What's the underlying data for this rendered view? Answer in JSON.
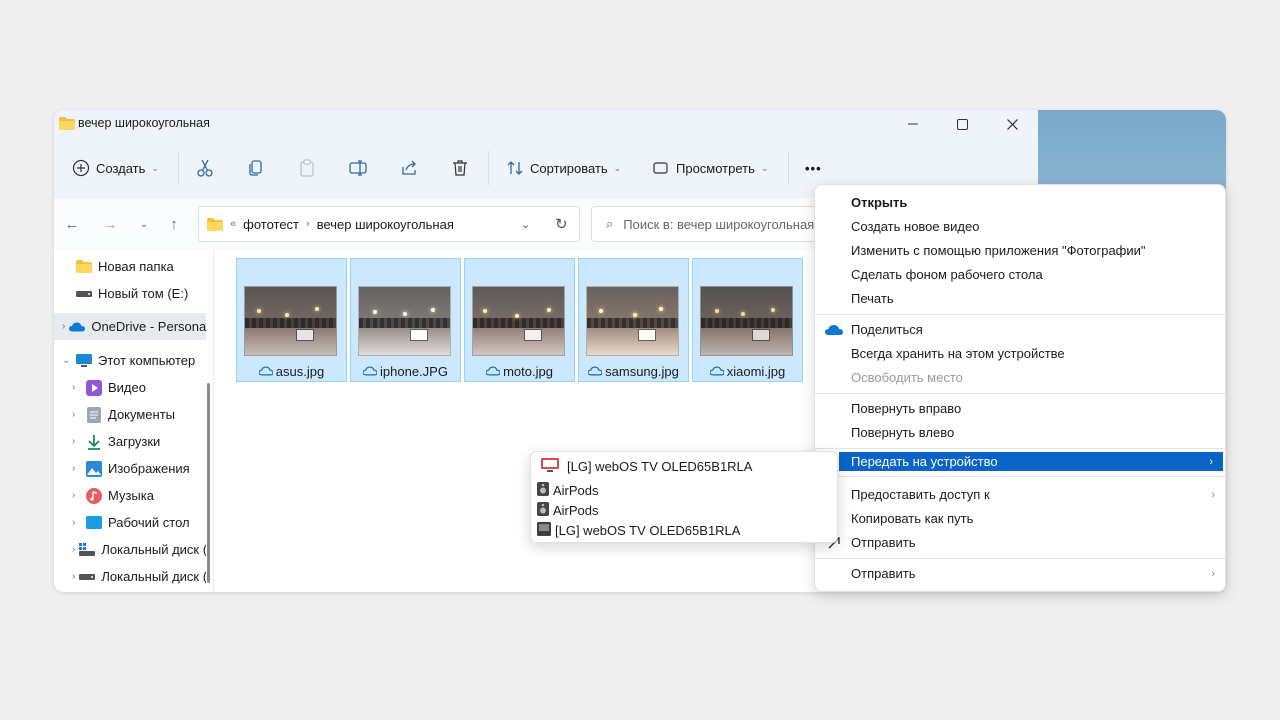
{
  "window": {
    "title": "вечер широкоугольная"
  },
  "toolbar": {
    "create_label": "Создать",
    "sort_label": "Сортировать",
    "view_label": "Просмотреть",
    "more_label": "•••"
  },
  "address": {
    "overflow": "«",
    "crumbs": [
      "фототест",
      "вечер широкоугольная"
    ]
  },
  "search": {
    "placeholder": "Поиск в: вечер широкоугольная"
  },
  "sidebar": {
    "items": [
      {
        "label": "Новая папка",
        "icon": "folder-icon"
      },
      {
        "label": "Новый том (E:)",
        "icon": "drive-icon"
      },
      {
        "label": "OneDrive - Personal",
        "icon": "onedrive-icon"
      },
      {
        "label": "Этот компьютер",
        "icon": "computer-icon"
      },
      {
        "label": "Видео",
        "icon": "video-icon"
      },
      {
        "label": "Документы",
        "icon": "documents-icon"
      },
      {
        "label": "Загрузки",
        "icon": "downloads-icon"
      },
      {
        "label": "Изображения",
        "icon": "images-icon"
      },
      {
        "label": "Музыка",
        "icon": "music-icon"
      },
      {
        "label": "Рабочий стол",
        "icon": "desktop-icon"
      },
      {
        "label": "Локальный диск (C:)",
        "icon": "windows-drive-icon"
      },
      {
        "label": "Локальный диск (D:)",
        "icon": "drive-icon"
      }
    ]
  },
  "files": [
    {
      "name": "asus.jpg"
    },
    {
      "name": "iphone.JPG"
    },
    {
      "name": "moto.jpg"
    },
    {
      "name": "samsung.jpg"
    },
    {
      "name": "xiaomi.jpg"
    }
  ],
  "context_menu": {
    "open": "Открыть",
    "new_video": "Создать новое видео",
    "edit_photos": "Изменить с помощью приложения \"Фотографии\"",
    "set_wallpaper": "Сделать фоном рабочего стола",
    "print": "Печать",
    "share": "Поделиться",
    "keep_device": "Всегда хранить на этом устройстве",
    "free_space": "Освободить место",
    "rotate_right": "Повернуть вправо",
    "rotate_left": "Повернуть влево",
    "cast": "Передать на устройство",
    "give_access": "Предоставить доступ к",
    "copy_path": "Копировать как путь",
    "send": "Отправить",
    "send_to": "Отправить"
  },
  "cast_submenu": {
    "devices": [
      {
        "label": "[LG] webOS TV OLED65B1RLA",
        "icon": "tv-icon"
      },
      {
        "label": "AirPods",
        "icon": "speaker-icon"
      },
      {
        "label": "AirPods",
        "icon": "speaker-icon"
      },
      {
        "label": "[LG] webOS TV OLED65B1RLA",
        "icon": "media-device-icon"
      }
    ]
  },
  "colors": {
    "accent": "#0a64c8",
    "selection": "#cce8ff",
    "titlebar": "#eef4f9"
  }
}
